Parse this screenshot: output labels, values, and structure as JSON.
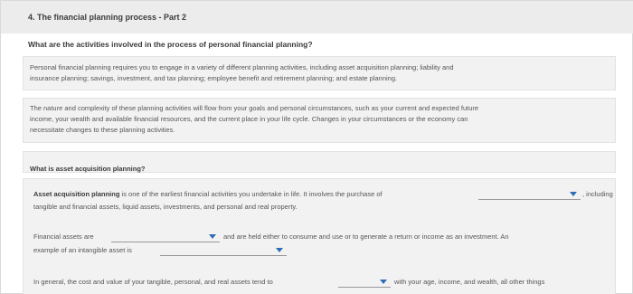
{
  "header": {
    "title": "4. The financial planning process - Part 2"
  },
  "question_heading": "What are the activities involved in the process of personal financial planning?",
  "intro": {
    "line1": "Personal financial planning requires you to engage in a variety of different planning activities, including asset acquisition planning; liability and",
    "line2": "insurance planning; savings, investment, and tax planning; employee benefit and retirement planning; and estate planning."
  },
  "nature": {
    "line1": "The nature and complexity of these planning activities will flow from your goals and personal circumstances, such as your current and expected future",
    "line2": "income, your wealth and available financial resources, and the current place in your life cycle. Changes in your circumstances or the economy can",
    "line3": "necessitate changes to these planning activities."
  },
  "sub_question": "What is asset acquisition planning?",
  "asset": {
    "term": "Asset acquisition planning",
    "text1": " is one of the earliest financial activities you undertake in life. It involves the purchase of",
    "after_dd1": ", including",
    "line2": "tangible and financial assets, liquid assets, investments, and personal and real property.",
    "dd1_value": ""
  },
  "financial": {
    "label1": "Financial assets are",
    "after_dd2": "and are held either to consume and use or to generate a return or income as an investment. An",
    "label2": "example of an intangible asset is",
    "dd2_value": "",
    "dd3_value": ""
  },
  "general": {
    "text1": "In general, the cost and value of your tangible, personal, and real assets tend to",
    "after_dd4": "with your age, income, and wealth, all other things",
    "dd4_value": ""
  },
  "colors": {
    "accent": "#2f6db5",
    "panel": "#f2f2f2",
    "header_bg": "#ececec"
  },
  "icons": {
    "dropdown": "chevron-down-icon"
  }
}
